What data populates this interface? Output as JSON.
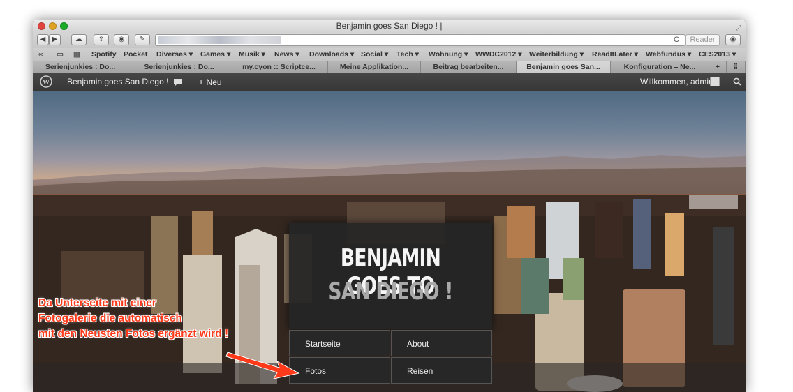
{
  "window": {
    "title": "Benjamin goes San Diego ! |"
  },
  "toolbar": {
    "reader_label": "Reader",
    "reload_icon": "C"
  },
  "bookmarks": [
    "Spotify",
    "Pocket",
    "Diverses ▾",
    "Games ▾",
    "Musik ▾",
    "News ▾",
    "Downloads ▾",
    "Social ▾",
    "Tech ▾",
    "Wohnung ▾",
    "WWDC2012 ▾",
    "Weiterbildung ▾",
    "ReadItLater ▾",
    "Webfundus ▾",
    "CES2013 ▾"
  ],
  "tabs": [
    "Serienjunkies : Do...",
    "Serienjunkies : Do...",
    "my.cyon :: Scriptce...",
    "Meine Applikation...",
    "Beitrag bearbeiten...",
    "Benjamin goes San...",
    "Konfiguration – Ne..."
  ],
  "adminbar": {
    "site_name": "Benjamin goes San Diego !",
    "new_label": "Neu",
    "welcome": "Willkommen, admin"
  },
  "site": {
    "title_line1": "BENJAMIN GOES TO",
    "title_line2": "SAN DIEGO !"
  },
  "nav": {
    "startseite": "Startseite",
    "about": "About",
    "fotos": "Fotos",
    "reisen": "Reisen"
  },
  "annotation": {
    "line1": "Da Unterseite mit einer",
    "line2": "Fotogalerie die automatisch",
    "line3": "mit den Neusten Fotos ergänzt wird !"
  },
  "colors": {
    "annotation": "#ff3a1a",
    "adminbar": "#3d3d3d"
  }
}
